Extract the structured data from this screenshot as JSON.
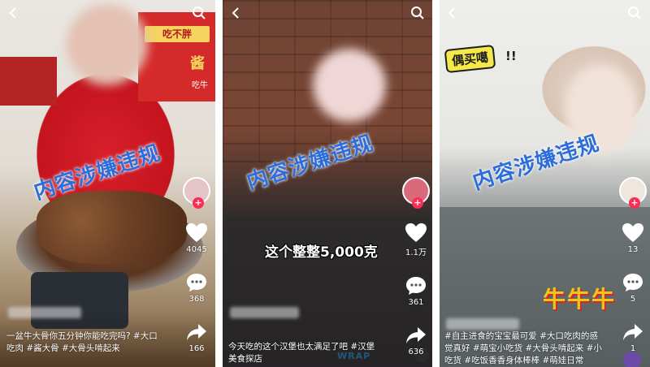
{
  "watermark": "内容涉嫌违规",
  "panels": [
    {
      "likes": "4045",
      "comments": "368",
      "shares": "166",
      "caption_line1": "一盆牛大骨你五分钟你能吃完吗? #大口",
      "caption_line2": "吃肉 #酱大骨 #大骨头啃起来",
      "background_sign": "吃不胖",
      "background_sign_char": "酱",
      "background_small_text": "吃牛"
    },
    {
      "likes": "1.1万",
      "comments": "361",
      "shares": "636",
      "overlay_text": "这个整整5,000克",
      "caption_line1": "今天吃的这个汉堡也太满足了吧 #汉堡",
      "caption_line2": "美食探店",
      "tray_text": "WRAP"
    },
    {
      "likes": "13",
      "comments": "5",
      "shares": "1",
      "sticker_text": "偶买噶",
      "sticker_bang": "!!",
      "overlay_text": "牛牛牛",
      "caption_line1": "#自主进食的宝宝最可爱 #大口吃肉的感",
      "caption_line2": "觉真好 #萌宝小吃货 #大骨头啃起来 #小",
      "caption_line3": "吃货 #吃饭香香身体棒棒 #萌娃日常"
    }
  ],
  "icons": {
    "back": "back-arrow-icon",
    "search": "search-icon",
    "like": "heart-icon",
    "comment": "comment-icon",
    "share": "share-icon",
    "follow": "follow-plus-icon"
  },
  "colors": {
    "watermark": "#2c6ddc",
    "follow_accent": "#fe2c55"
  },
  "follow_symbol": "+"
}
